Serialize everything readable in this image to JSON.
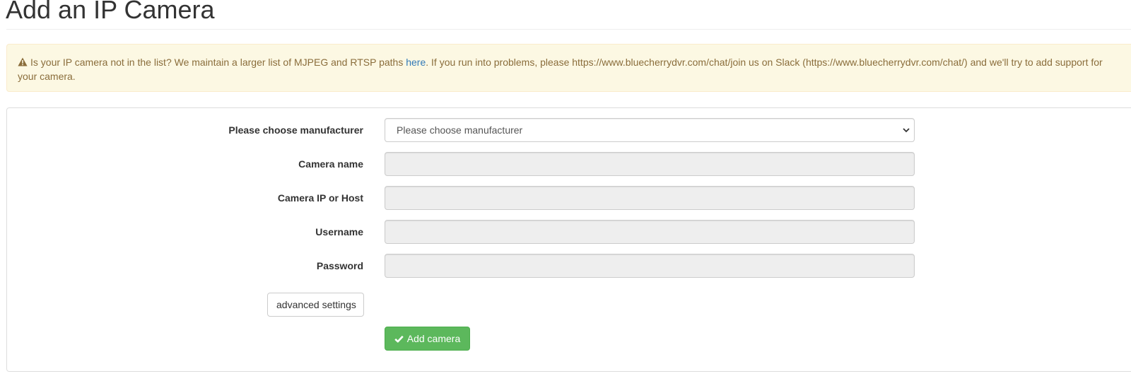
{
  "page": {
    "title": "Add an IP Camera"
  },
  "alert": {
    "icon": "warning-icon",
    "text_before_link": "Is your IP camera not in the list? We maintain a larger list of MJPEG and RTSP paths ",
    "link_text": "here",
    "text_after_link": ". If you run into problems, please https://www.bluecherrydvr.com/chat/join us on Slack (https://www.bluecherrydvr.com/chat/) and we'll try to add support for your camera.",
    "colors": {
      "background": "#fcf8e3",
      "text": "#8a6d3b",
      "link": "#337ab7"
    }
  },
  "form": {
    "manufacturer": {
      "label": "Please choose manufacturer",
      "selected": "Please choose manufacturer"
    },
    "camera_name": {
      "label": "Camera name",
      "value": ""
    },
    "camera_host": {
      "label": "Camera IP or Host",
      "value": ""
    },
    "username": {
      "label": "Username",
      "value": ""
    },
    "password": {
      "label": "Password",
      "value": ""
    },
    "advanced_button": "advanced settings",
    "submit_button": {
      "label": "Add camera",
      "icon": "check-icon",
      "color": "#5cb85c"
    }
  }
}
